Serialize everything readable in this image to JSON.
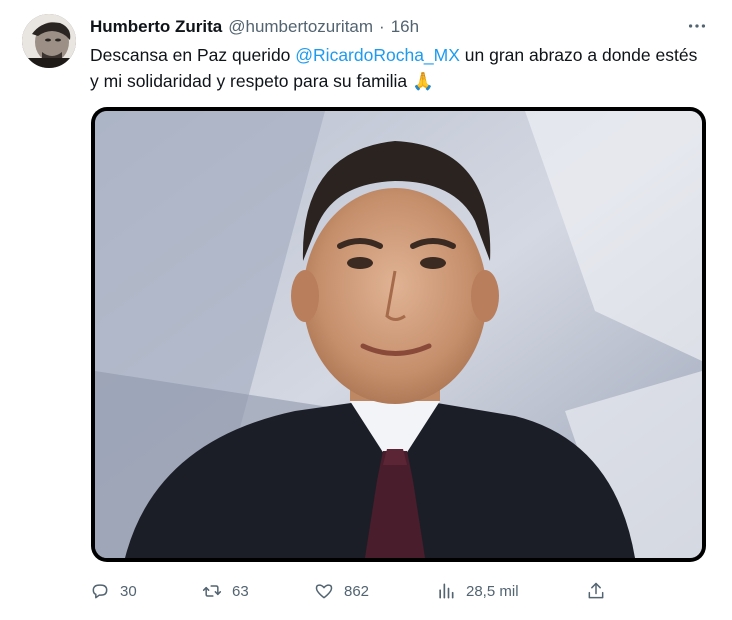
{
  "tweet": {
    "author_name": "Humberto Zurita",
    "author_handle": "@humbertozuritam",
    "separator": "·",
    "time": "16h",
    "text_part1": "Descansa en Paz querido ",
    "mention": "@RicardoRocha_MX",
    "text_part2": "  un gran abrazo a donde estés y mi solidaridad y respeto para su familia ",
    "emoji": "🙏"
  },
  "actions": {
    "replies": "30",
    "retweets": "63",
    "likes": "862",
    "views": "28,5 mil"
  },
  "icons": {
    "more": "more-icon",
    "reply": "reply-icon",
    "retweet": "retweet-icon",
    "like": "heart-icon",
    "views": "views-icon",
    "share": "share-icon"
  },
  "colors": {
    "link": "#1d9bf0",
    "secondary_text": "#536471",
    "primary_text": "#0f1419"
  }
}
